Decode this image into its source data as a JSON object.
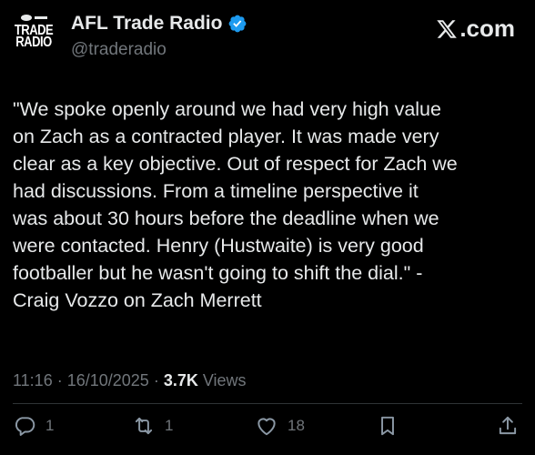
{
  "author": {
    "avatar_line1": "TRADE",
    "avatar_line2": "RADIO",
    "display_name": "AFL Trade Radio",
    "handle": "@traderadio",
    "verified": true
  },
  "source": {
    "x_label": ".com",
    "icon": "x-logo-icon"
  },
  "tweet": {
    "text": "\"We spoke openly around we had very high value\non Zach as a contracted player. It was made very\nclear as a key objective. Out of respect for Zach we\nhad discussions. From a timeline perspective it\nwas about 30 hours before the deadline when we\nwere contacted. Henry (Hustwaite) is very good\nfootballer but he wasn't going to shift the dial.\" -\nCraig Vozzo on Zach Merrett"
  },
  "meta": {
    "time": "11:16",
    "sep1": "·",
    "date": "16/10/2025",
    "sep2": "·",
    "views_count": "3.7K",
    "views_label": "Views"
  },
  "actions": {
    "replies": "1",
    "reposts": "1",
    "likes": "18"
  },
  "colors": {
    "background": "#000000",
    "text": "#e7e9ea",
    "muted": "#71767b",
    "verified": "#1d9bf0"
  }
}
